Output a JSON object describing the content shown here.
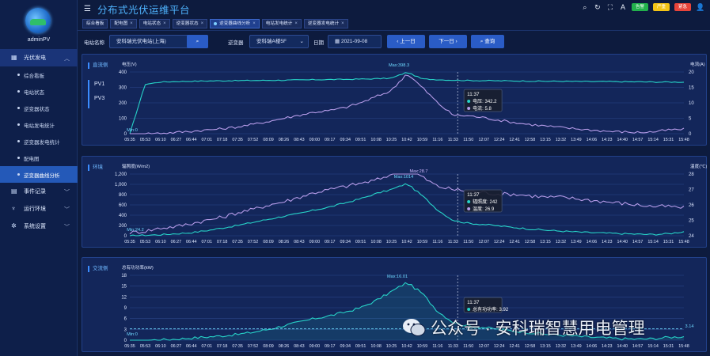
{
  "user": {
    "name": "adminPV"
  },
  "app": {
    "title": "分布式光伏运维平台"
  },
  "header": {
    "badges": [
      {
        "label": "告警",
        "color": "#22b14c"
      },
      {
        "label": "严重",
        "color": "#f3c416"
      },
      {
        "label": "紧急",
        "color": "#e8443a"
      }
    ]
  },
  "sidebar": {
    "groups": [
      {
        "label": "光伏发电",
        "icon": "grid-icon",
        "expanded": true,
        "items": [
          "综合看板",
          "电站状态",
          "逆变器状态",
          "电站发电统计",
          "逆变器发电统计",
          "配电图",
          "逆变器曲线分析"
        ],
        "active_item": "逆变器曲线分析"
      },
      {
        "label": "事件记录",
        "icon": "event-icon"
      },
      {
        "label": "运行环境",
        "icon": "env-icon"
      },
      {
        "label": "系统设置",
        "icon": "settings-icon"
      }
    ]
  },
  "tabs": [
    {
      "label": "综合看板"
    },
    {
      "label": "配电图"
    },
    {
      "label": "电站状态"
    },
    {
      "label": "逆变器状态"
    },
    {
      "label": "逆变器曲线分析",
      "active": true
    },
    {
      "label": "电站发电统计"
    },
    {
      "label": "逆变器发电统计"
    }
  ],
  "filter": {
    "station_label": "电站名称",
    "station_value": "安科瑞光伏电站(上海)",
    "inverter_label": "逆变器",
    "inverter_value": "安科瑞A楼5F",
    "date_label": "日期",
    "date_value": "2021-09-08",
    "prev_label": "上一日",
    "next_label": "下一日",
    "query_label": "查询"
  },
  "time_ticks": [
    "05:35",
    "05:53",
    "06:10",
    "06:27",
    "06:44",
    "07:01",
    "07:18",
    "07:35",
    "07:52",
    "08:09",
    "08:26",
    "08:43",
    "09:00",
    "09:17",
    "09:34",
    "09:51",
    "10:08",
    "10:25",
    "10:42",
    "10:59",
    "11:16",
    "11:33",
    "11:50",
    "12:07",
    "12:24",
    "12:41",
    "12:58",
    "13:15",
    "13:32",
    "13:49",
    "14:06",
    "14:23",
    "14:40",
    "14:57",
    "15:14",
    "15:31",
    "15:48"
  ],
  "panels": {
    "dc": {
      "title": "直流侧",
      "pv_items": [
        "PV1",
        "PV3"
      ],
      "y_left_label": "电压(V)",
      "y_right_label": "电流(A)",
      "y_left_ticks": [
        "400",
        "300",
        "200",
        "100",
        "0"
      ],
      "y_right_ticks": [
        "20",
        "15",
        "10",
        "5",
        "0"
      ],
      "max_label": "Max:398.3",
      "min_label": "Min:0",
      "tooltip": {
        "time": "11:37",
        "lines": [
          "电压: 342.2",
          "电流: 5.8"
        ]
      }
    },
    "env": {
      "title": "环境",
      "y_left_label": "辐照度(W/m2)",
      "y_right_label": "温度(℃)",
      "y_left_ticks": [
        "1,200",
        "1,000",
        "800",
        "600",
        "400",
        "200",
        "0"
      ],
      "y_right_ticks": [
        "28",
        "27",
        "26",
        "25",
        "24"
      ],
      "max_label_1": "Max:1014",
      "max_label_2": "Max:28.7",
      "min_label": "Min:24.2",
      "tooltip": {
        "time": "11:37",
        "lines": [
          "辐照度: 242",
          "温度: 26.9"
        ]
      }
    },
    "ac": {
      "title": "交流侧",
      "y_left_label": "总有功功率(kW)",
      "y_left_ticks": [
        "18",
        "15",
        "12",
        "9",
        "6",
        "3",
        "0"
      ],
      "max_label": "Max:16.01",
      "min_label": "Min:0",
      "avg_label": "3.14",
      "tooltip": {
        "time": "11:37",
        "lines": [
          "总有功功率: 3.92"
        ]
      }
    }
  },
  "chart_data": [
    {
      "type": "line",
      "title": "直流侧",
      "x_range": [
        "05:35",
        "15:48"
      ],
      "series": [
        {
          "name": "电压",
          "unit": "V",
          "values": [
            0,
            320,
            335,
            338,
            340,
            342,
            343,
            344,
            345,
            346,
            347,
            348,
            350,
            351,
            352,
            354,
            356,
            360,
            398.3,
            355,
            350,
            347,
            345,
            344,
            343,
            342,
            341,
            340,
            340,
            339,
            338,
            338,
            337,
            336,
            335,
            335,
            334
          ]
        },
        {
          "name": "电流",
          "unit": "A",
          "values": [
            0,
            0,
            0.2,
            0.4,
            0.8,
            1.2,
            1.6,
            2.2,
            3,
            4,
            5,
            6,
            7,
            7.5,
            8.5,
            10,
            12,
            14,
            19.5,
            15,
            10,
            6,
            5.8,
            5.2,
            4.4,
            3.6,
            3,
            2.5,
            2,
            1.6,
            1.2,
            0.8,
            0.6,
            0.4,
            0.6,
            1.2,
            1.4
          ]
        }
      ],
      "ylim_left": [
        0,
        400
      ],
      "ylim_right": [
        0,
        20
      ]
    },
    {
      "type": "line",
      "title": "环境",
      "x_range": [
        "05:35",
        "15:48"
      ],
      "series": [
        {
          "name": "辐照度",
          "unit": "W/m2",
          "values": [
            0,
            10,
            20,
            40,
            60,
            100,
            150,
            200,
            260,
            320,
            380,
            430,
            500,
            560,
            640,
            720,
            820,
            900,
            1014,
            780,
            500,
            300,
            242,
            220,
            190,
            160,
            130,
            110,
            90,
            75,
            60,
            50,
            40,
            30,
            25,
            40,
            80
          ]
        },
        {
          "name": "温度",
          "unit": "℃",
          "values": [
            24.2,
            24.3,
            24.5,
            24.6,
            24.8,
            25,
            25.2,
            25.5,
            25.7,
            26,
            26.2,
            26.5,
            26.8,
            27,
            27.2,
            27.4,
            27.6,
            28,
            28.7,
            27.8,
            27.2,
            27,
            26.9,
            26.8,
            26.7,
            26.7,
            26.6,
            26.5,
            26.5,
            26.4,
            26.3,
            26.2,
            26.1,
            26,
            25.9,
            25.9,
            25.8
          ]
        }
      ],
      "ylim_left": [
        0,
        1200
      ],
      "ylim_right": [
        24,
        28
      ]
    },
    {
      "type": "line",
      "title": "交流侧",
      "x_range": [
        "05:35",
        "15:48"
      ],
      "series": [
        {
          "name": "总有功功率",
          "unit": "kW",
          "values": [
            0,
            0,
            0.1,
            0.3,
            0.6,
            0.9,
            1.2,
            1.6,
            2.2,
            3,
            4,
            5,
            6,
            6.8,
            7.8,
            9,
            11,
            13.5,
            16.01,
            13,
            8,
            5,
            3.92,
            3.5,
            3,
            2.5,
            2.1,
            1.7,
            1.4,
            1.1,
            0.8,
            0.6,
            0.4,
            0.3,
            0.4,
            0.8,
            1
          ]
        }
      ],
      "ylim_left": [
        0,
        18
      ],
      "avg": 3.14
    }
  ],
  "watermark": {
    "text": "公众号 · 安科瑞智慧用电管理"
  }
}
